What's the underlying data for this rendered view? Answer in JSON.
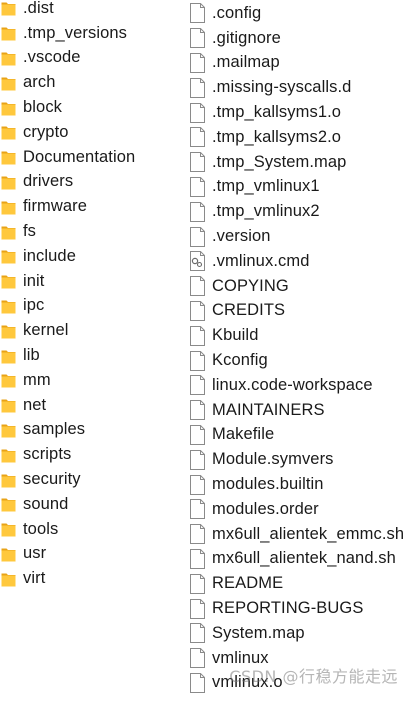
{
  "folders": [
    {
      "name": ".dist"
    },
    {
      "name": ".tmp_versions"
    },
    {
      "name": ".vscode"
    },
    {
      "name": "arch"
    },
    {
      "name": "block"
    },
    {
      "name": "crypto"
    },
    {
      "name": "Documentation"
    },
    {
      "name": "drivers"
    },
    {
      "name": "firmware"
    },
    {
      "name": "fs"
    },
    {
      "name": "include"
    },
    {
      "name": "init"
    },
    {
      "name": "ipc"
    },
    {
      "name": "kernel"
    },
    {
      "name": "lib"
    },
    {
      "name": "mm"
    },
    {
      "name": "net"
    },
    {
      "name": "samples"
    },
    {
      "name": "scripts"
    },
    {
      "name": "security"
    },
    {
      "name": "sound"
    },
    {
      "name": "tools"
    },
    {
      "name": "usr"
    },
    {
      "name": "virt"
    }
  ],
  "files": [
    {
      "name": ".config",
      "icon": "file-icon"
    },
    {
      "name": ".gitignore",
      "icon": "file-icon"
    },
    {
      "name": ".mailmap",
      "icon": "file-icon"
    },
    {
      "name": ".missing-syscalls.d",
      "icon": "file-icon"
    },
    {
      "name": ".tmp_kallsyms1.o",
      "icon": "file-icon"
    },
    {
      "name": ".tmp_kallsyms2.o",
      "icon": "file-icon"
    },
    {
      "name": ".tmp_System.map",
      "icon": "file-icon"
    },
    {
      "name": ".tmp_vmlinux1",
      "icon": "file-icon"
    },
    {
      "name": ".tmp_vmlinux2",
      "icon": "file-icon"
    },
    {
      "name": ".version",
      "icon": "file-icon"
    },
    {
      "name": ".vmlinux.cmd",
      "icon": "cmd-file-icon"
    },
    {
      "name": "COPYING",
      "icon": "file-icon"
    },
    {
      "name": "CREDITS",
      "icon": "file-icon"
    },
    {
      "name": "Kbuild",
      "icon": "file-icon"
    },
    {
      "name": "Kconfig",
      "icon": "file-icon"
    },
    {
      "name": "linux.code-workspace",
      "icon": "file-icon"
    },
    {
      "name": "MAINTAINERS",
      "icon": "file-icon"
    },
    {
      "name": "Makefile",
      "icon": "file-icon"
    },
    {
      "name": "Module.symvers",
      "icon": "file-icon"
    },
    {
      "name": "modules.builtin",
      "icon": "file-icon"
    },
    {
      "name": "modules.order",
      "icon": "file-icon"
    },
    {
      "name": "mx6ull_alientek_emmc.sh",
      "icon": "file-icon"
    },
    {
      "name": "mx6ull_alientek_nand.sh",
      "icon": "file-icon"
    },
    {
      "name": "README",
      "icon": "file-icon"
    },
    {
      "name": "REPORTING-BUGS",
      "icon": "file-icon"
    },
    {
      "name": "System.map",
      "icon": "file-icon"
    },
    {
      "name": "vmlinux",
      "icon": "file-icon"
    },
    {
      "name": "vmlinux.o",
      "icon": "file-icon"
    }
  ],
  "watermark": "CSDN @行稳方能走远",
  "colors": {
    "folder_front": "#FFC83D",
    "folder_back": "#E8A317",
    "file_border": "#8a8a8a",
    "text": "#1a1a1a"
  }
}
